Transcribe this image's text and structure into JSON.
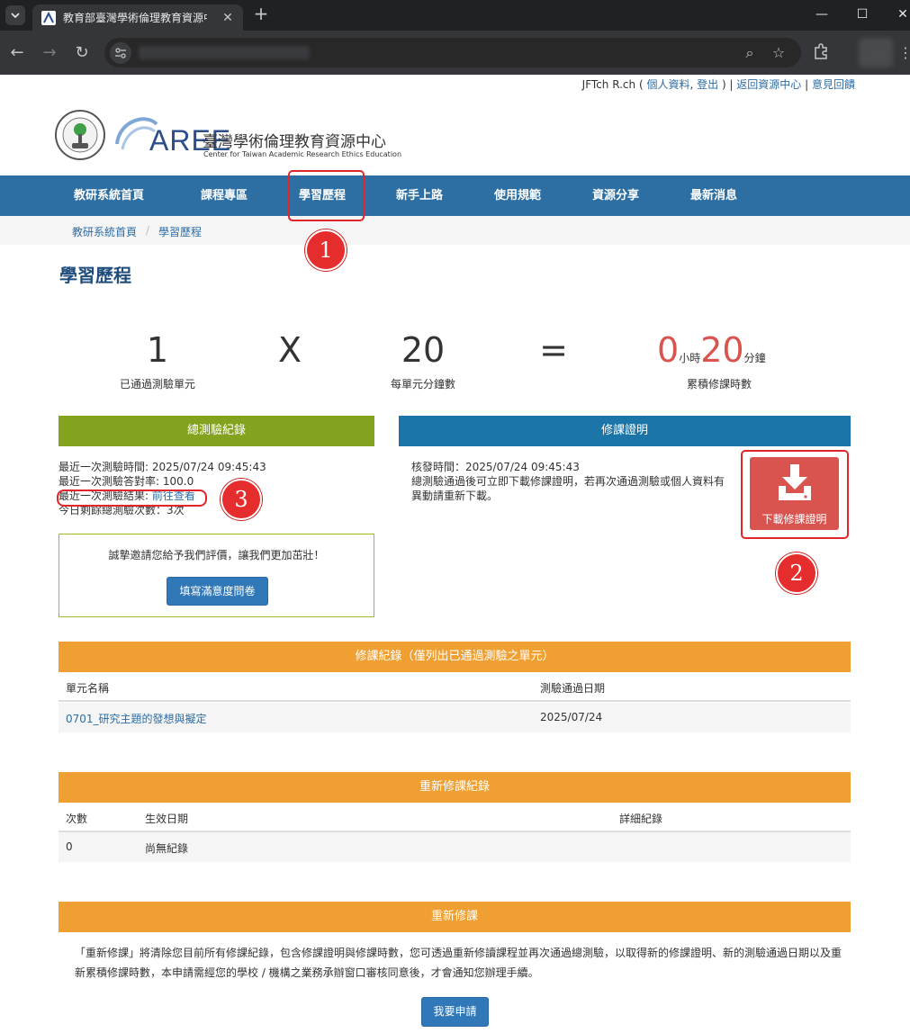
{
  "browser": {
    "tab_title": "教育部臺灣學術倫理教育資源中",
    "close_glyph": "✕",
    "new_tab_glyph": "+",
    "window_controls": {
      "minimize": "—",
      "maximize": "☐",
      "close": "✕"
    },
    "nav": {
      "back": "←",
      "forward": "→",
      "reload": "↻"
    },
    "omnibox_icons": {
      "zoom": "⌕",
      "star": "☆"
    },
    "menu": "⋮"
  },
  "userbar": {
    "user": "JFTch R.ch",
    "open_paren": " ( ",
    "profile": "個人資料",
    "comma": ", ",
    "logout": "登出",
    "close_paren": " ) | ",
    "back_to_center": "返回資源中心",
    "separator": " | ",
    "feedback": "意見回饋"
  },
  "logo": {
    "aree": "AREE",
    "center_name": "臺灣學術倫理教育資源中心",
    "center_eng": "Center for Taiwan Academic Research Ethics Education"
  },
  "nav": {
    "items": [
      "教研系統首頁",
      "課程專區",
      "學習歷程",
      "新手上路",
      "使用規範",
      "資源分享",
      "最新消息"
    ]
  },
  "breadcrumb": {
    "home": "教研系統首頁",
    "sep": "/",
    "current": "學習歷程"
  },
  "page_title": "學習歷程",
  "stats": {
    "units_passed": "1",
    "units_label": "已通過測驗單元",
    "times_sign": "X",
    "minutes_per_unit": "20",
    "minutes_label": "每單元分鐘數",
    "equals_sign": "=",
    "hours": "0",
    "hours_unit": "小時",
    "minutes": "20",
    "minutes_unit": "分鐘",
    "total_label": "累積修課時數"
  },
  "exam_panel": {
    "title": "總測驗紀錄",
    "last_time": "最近一次測驗時間: 2025/07/24 09:45:43",
    "last_score": "最近一次測驗答對率: 100.0",
    "last_result_label": "最近一次測驗結果: ",
    "last_result_link": "前往查看",
    "remaining": "今日剩餘總測驗次數：3次",
    "survey_text": "誠摯邀請您給予我們評價，讓我們更加茁壯！",
    "survey_button": "填寫滿意度問卷"
  },
  "cert_panel": {
    "title": "修課證明",
    "issue_time": "核發時間：2025/07/24 09:45:43",
    "note": "總測驗通過後可立即下載修課證明，若再次通過測驗或個人資料有異動請重新下載。",
    "download_button": "下載修課證明"
  },
  "course_records": {
    "title": "修課紀錄（僅列出已通過測驗之單元）",
    "columns": [
      "單元名稱",
      "測驗通過日期"
    ],
    "rows": [
      [
        "0701_研究主題的發想與擬定",
        "2025/07/24"
      ]
    ]
  },
  "retake_records": {
    "title": "重新修課紀錄",
    "columns": [
      "次數",
      "生效日期",
      "詳細紀錄"
    ],
    "rows": [
      [
        "0",
        "尚無紀錄",
        ""
      ]
    ]
  },
  "retake": {
    "title": "重新修課",
    "note": "「重新修課」將清除您目前所有修課紀錄，包含修課證明與修課時數，您可透過重新修讀課程並再次通過總測驗，以取得新的修課證明、新的測驗通過日期以及重新累積修課時數，本申請需經您的學校 / 機構之業務承辦窗口審核同意後，才會通知您辦理手續。",
    "button": "我要申請"
  },
  "annotations": [
    "1",
    "2",
    "3"
  ],
  "colors": {
    "nav_blue": "#2e6fa3",
    "green_header": "#83a31f",
    "blue_header": "#1b75a8",
    "orange_header": "#f0a032",
    "download_red": "#d9534f",
    "annotation_red": "#e52d2d"
  }
}
